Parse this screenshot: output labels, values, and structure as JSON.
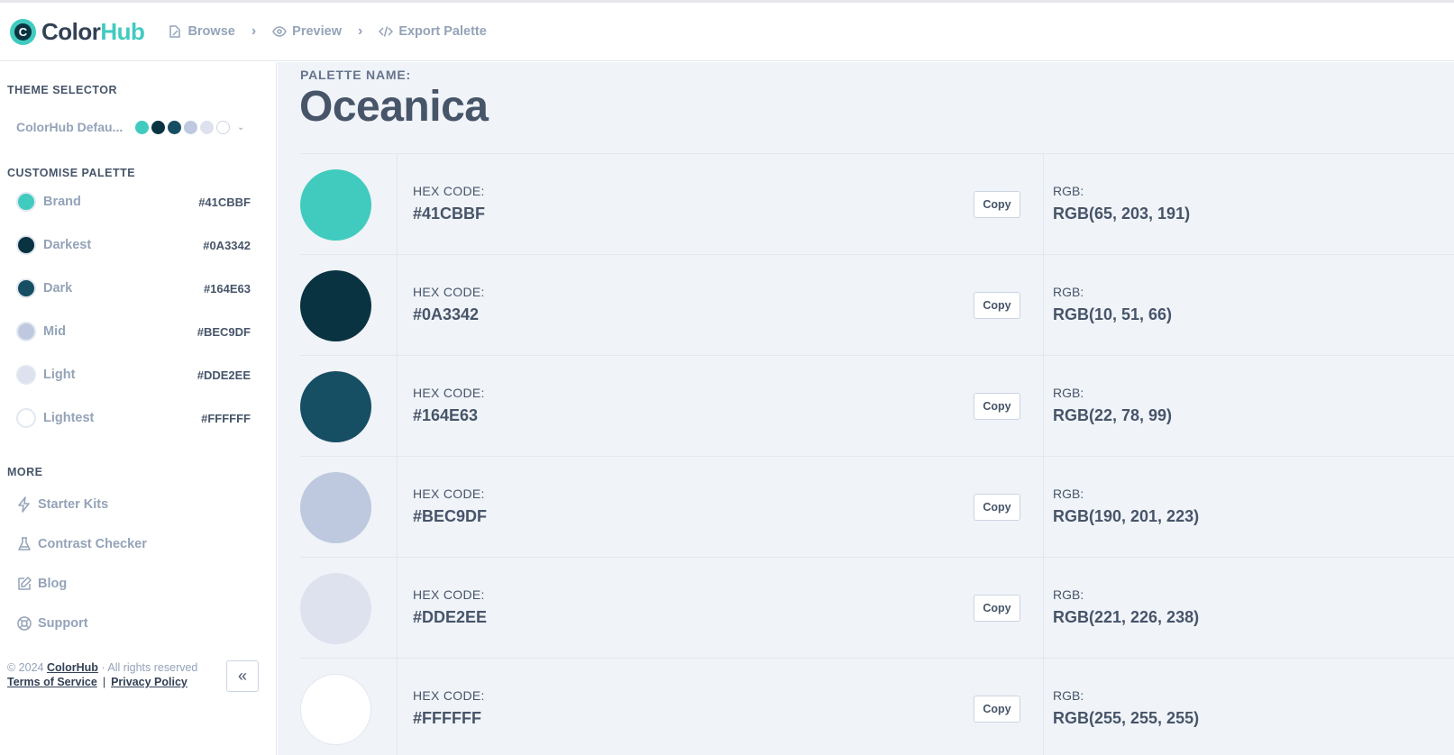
{
  "app": {
    "brand_part1": "Color",
    "brand_part2": "Hub",
    "brand_color": "#41CBBF"
  },
  "breadcrumbs": [
    {
      "label": "Browse",
      "icon": "browse-icon"
    },
    {
      "label": "Preview",
      "icon": "eye-icon"
    },
    {
      "label": "Export Palette",
      "icon": "code-icon"
    }
  ],
  "sidebar": {
    "theme_title": "THEME SELECTOR",
    "theme_name": "ColorHub Defau...",
    "theme_colors": [
      "#41CBBF",
      "#0A3342",
      "#164E63",
      "#BEC9DF",
      "#DDE2EE",
      "#FFFFFF"
    ],
    "customise_title": "CUSTOMISE PALETTE",
    "palette": [
      {
        "name": "Brand",
        "hex": "#41CBBF"
      },
      {
        "name": "Darkest",
        "hex": "#0A3342"
      },
      {
        "name": "Dark",
        "hex": "#164E63"
      },
      {
        "name": "Mid",
        "hex": "#BEC9DF"
      },
      {
        "name": "Light",
        "hex": "#DDE2EE"
      },
      {
        "name": "Lightest",
        "hex": "#FFFFFF"
      }
    ],
    "more_title": "MORE",
    "more_items": [
      {
        "label": "Starter Kits",
        "icon": "lightning-icon"
      },
      {
        "label": "Contrast Checker",
        "icon": "flask-icon"
      },
      {
        "label": "Blog",
        "icon": "edit-icon"
      },
      {
        "label": "Support",
        "icon": "lifebuoy-icon"
      }
    ],
    "footer": {
      "copyright": "© 2024",
      "brand_link": "ColorHub",
      "rights": "· All rights reserved",
      "terms": "Terms of Service",
      "divider": "|",
      "privacy": "Privacy Policy"
    },
    "collapse_glyph": "«"
  },
  "main": {
    "palette_label": "PALETTE NAME:",
    "palette_name": "Oceanica",
    "hex_label": "HEX CODE:",
    "rgb_label": "RGB:",
    "copy_label": "Copy",
    "rows": [
      {
        "hex": "#41CBBF",
        "rgb": "RGB(65, 203, 191)"
      },
      {
        "hex": "#0A3342",
        "rgb": "RGB(10, 51, 66)"
      },
      {
        "hex": "#164E63",
        "rgb": "RGB(22, 78, 99)"
      },
      {
        "hex": "#BEC9DF",
        "rgb": "RGB(190, 201, 223)"
      },
      {
        "hex": "#DDE2EE",
        "rgb": "RGB(221, 226, 238)"
      },
      {
        "hex": "#FFFFFF",
        "rgb": "RGB(255, 255, 255)"
      }
    ]
  }
}
